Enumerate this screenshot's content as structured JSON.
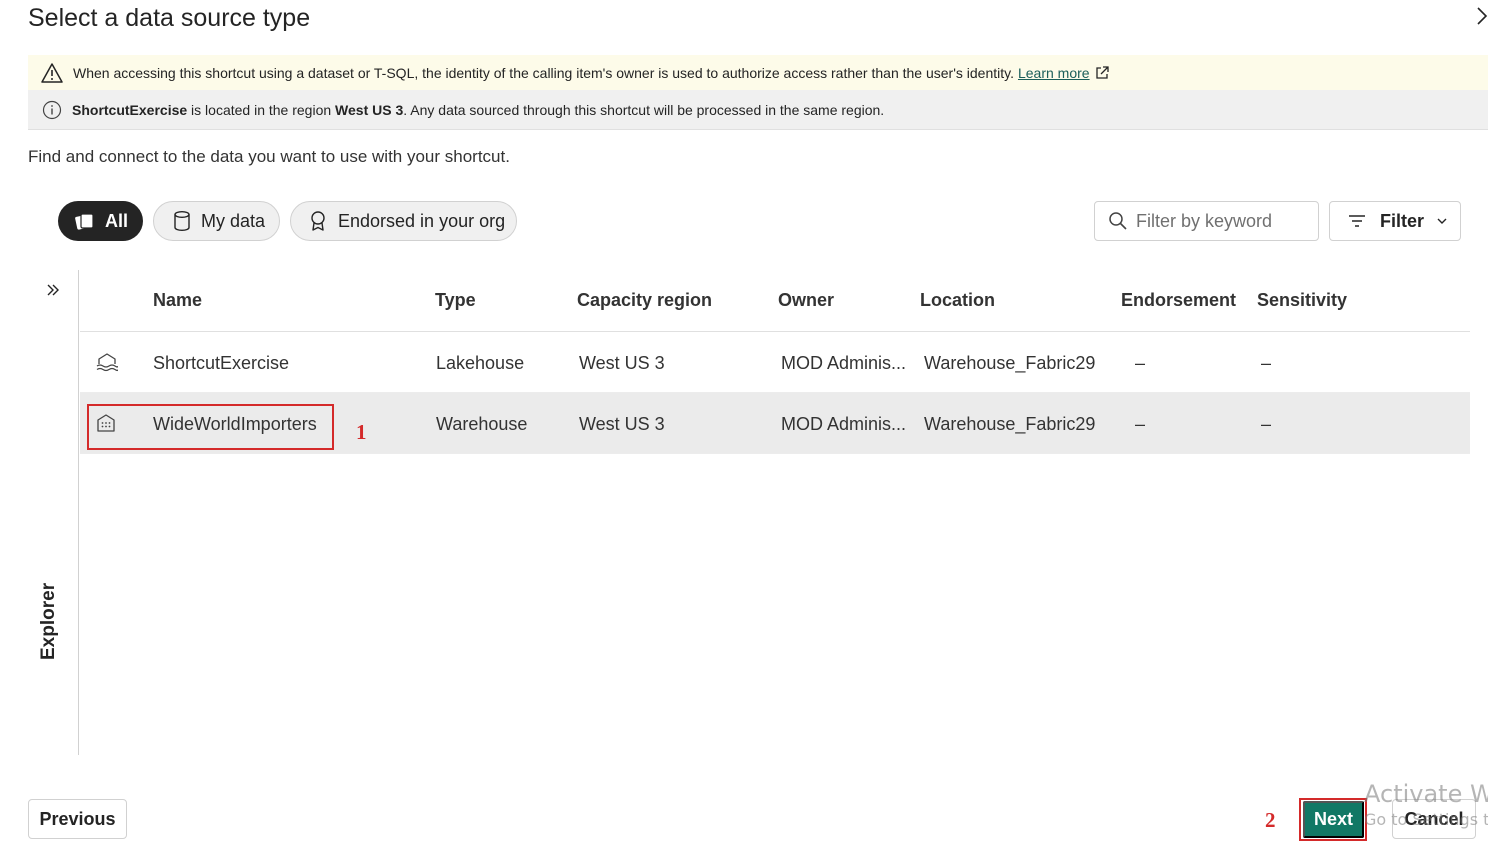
{
  "dialog": {
    "title": "Select a data source type"
  },
  "warning_bar": {
    "text": "When accessing this shortcut using a dataset or T-SQL, the identity of the calling item's owner is used to authorize access rather than the user's identity.",
    "link": "Learn more"
  },
  "info_bar": {
    "item": "ShortcutExercise",
    "text_1": " is located in the region ",
    "region": "West US 3",
    "text_2": ". Any data sourced through this shortcut will be processed in the same region."
  },
  "intro": "Find and connect to the data you want to use with your shortcut.",
  "pills": {
    "all": "All",
    "my_data": "My data",
    "endorsed": "Endorsed in your org"
  },
  "search": {
    "placeholder": "Filter by keyword"
  },
  "filter": {
    "label": "Filter"
  },
  "explorer": {
    "label": "Explorer"
  },
  "table": {
    "headers": {
      "name": "Name",
      "type": "Type",
      "region": "Capacity region",
      "owner": "Owner",
      "location": "Location",
      "endorsement": "Endorsement",
      "sensitivity": "Sensitivity"
    },
    "rows": [
      {
        "name": "ShortcutExercise",
        "type": "Lakehouse",
        "region": "West US 3",
        "owner": "MOD Adminis...",
        "location": "Warehouse_Fabric29",
        "endorsement": "–",
        "sensitivity": "–",
        "icon": "lakehouse-icon"
      },
      {
        "name": "WideWorldImporters",
        "type": "Warehouse",
        "region": "West US 3",
        "owner": "MOD Adminis...",
        "location": "Warehouse_Fabric29",
        "endorsement": "–",
        "sensitivity": "–",
        "icon": "warehouse-icon"
      }
    ]
  },
  "annotations": {
    "step1": "1",
    "step2": "2"
  },
  "buttons": {
    "previous": "Previous",
    "next": "Next",
    "cancel": "Cancel"
  },
  "watermark": {
    "line1": "Activate Wi",
    "line2": "Go to Settings t"
  },
  "colors": {
    "accent": "#117865",
    "highlight": "#d42a2a",
    "link": "#1a5e59"
  }
}
